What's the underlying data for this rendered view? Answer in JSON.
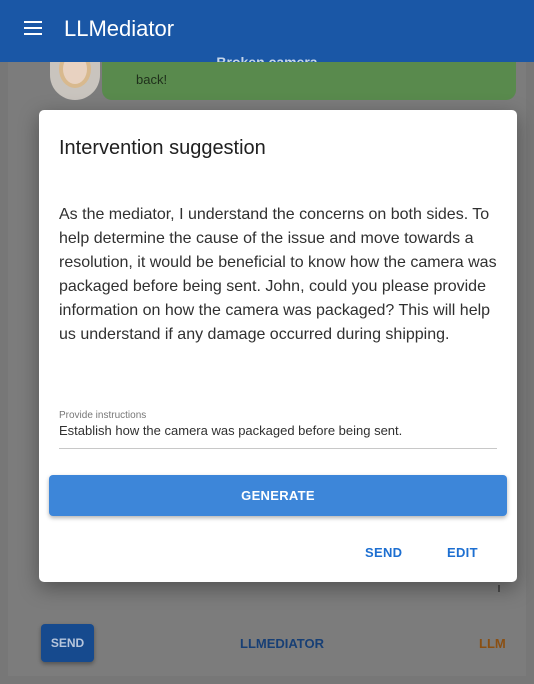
{
  "app": {
    "title": "LLMediator"
  },
  "conversation": {
    "title": "Broken camera",
    "last_message_fragment": "back!"
  },
  "dialog": {
    "title": "Intervention suggestion",
    "body": "As the mediator, I understand the concerns on both sides. To help determine the cause of the issue and move towards a resolution, it would be beneficial to know how the camera was packaged before being sent. John, could you please provide information on how the camera was packaged? This will help us understand if any damage occurred during shipping.",
    "instructions_label": "Provide instructions",
    "instructions_value": "Establish how the camera was packaged before being sent.",
    "generate_label": "GENERATE",
    "send_label": "SEND",
    "edit_label": "EDIT"
  },
  "bottom_bar": {
    "send_label": "SEND",
    "llmediator_label": "LLMEDIATOR",
    "llm_label": "LLM"
  },
  "colors": {
    "appbar": "#1a57a6",
    "primary_button": "#3d86d9",
    "text_button": "#1d6fd1",
    "bubble": "#598a4d",
    "llm_accent": "#8a4f12"
  },
  "icons": [
    "menu-icon",
    "avatar"
  ]
}
